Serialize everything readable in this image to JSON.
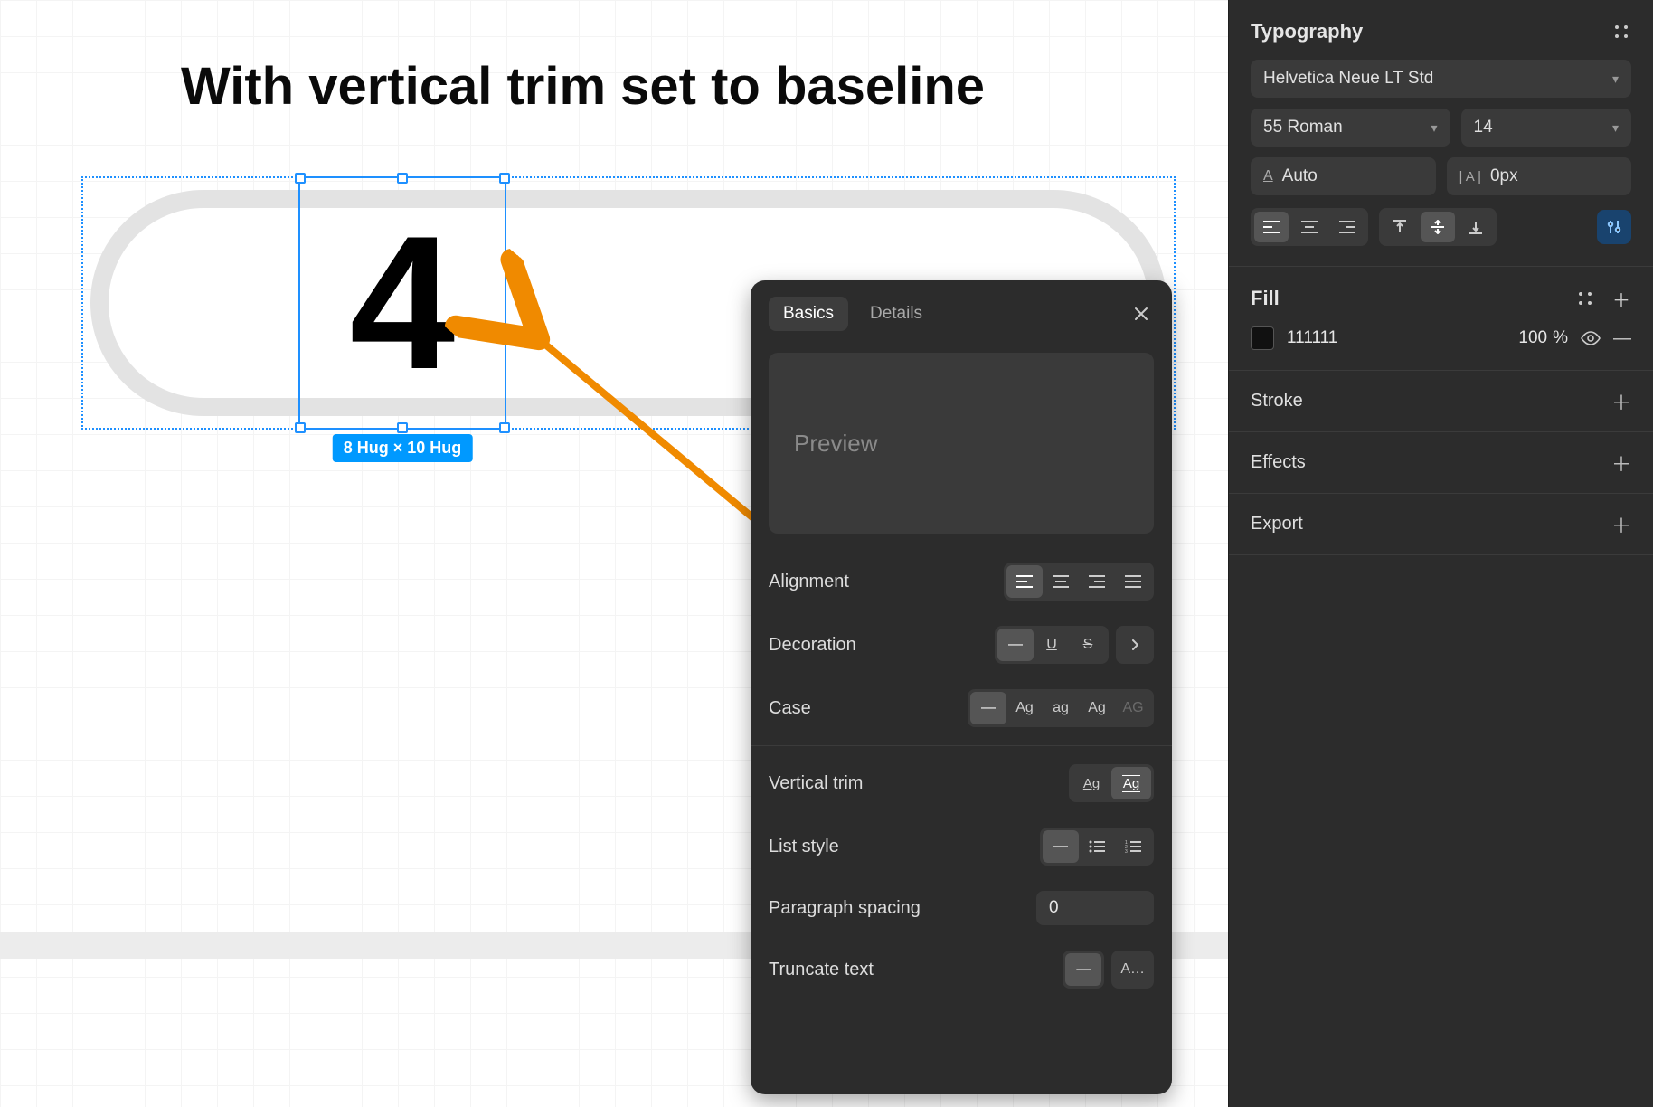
{
  "canvas": {
    "title": "With vertical trim set to baseline",
    "big_char": "4",
    "size_badge": "8 Hug × 10 Hug"
  },
  "float_panel": {
    "tabs": {
      "basics": "Basics",
      "details": "Details"
    },
    "preview_placeholder": "Preview",
    "rows": {
      "alignment": "Alignment",
      "decoration": "Decoration",
      "case": "Case",
      "vertical_trim": "Vertical trim",
      "list_style": "List style",
      "paragraph_spacing": "Paragraph spacing",
      "truncate_text": "Truncate text"
    },
    "case_labels": {
      "dash": "—",
      "ag_upper": "Ag",
      "ag_lower": "ag",
      "ag_mid": "Ag",
      "ag_sc": "AG"
    },
    "vertical_trim_labels": {
      "none": "Ag",
      "cap": "Ag"
    },
    "paragraph_spacing_value": "0",
    "truncate_labels": {
      "none": "—",
      "end": "A…"
    }
  },
  "inspector": {
    "typography": {
      "title": "Typography",
      "font_family": "Helvetica Neue LT Std",
      "font_weight": "55 Roman",
      "font_size": "14",
      "line_height": "Auto",
      "letter_spacing": "0px",
      "letter_spacing_prefix": "| A |"
    },
    "fill": {
      "title": "Fill",
      "color_hex": "111111",
      "swatch_color": "#111111",
      "opacity": "100",
      "opacity_unit": "%"
    },
    "stroke_title": "Stroke",
    "effects_title": "Effects",
    "export_title": "Export"
  }
}
